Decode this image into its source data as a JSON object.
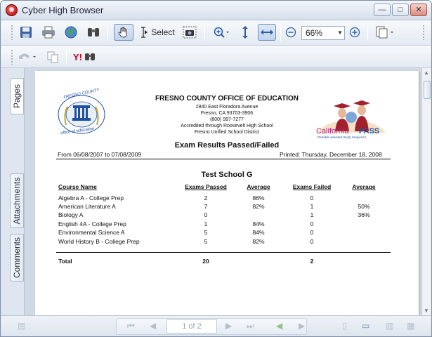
{
  "window": {
    "title": "Cyber High Browser",
    "buttons": {
      "minimize": "—",
      "maximize": "□",
      "close": "✕"
    }
  },
  "toolbar": {
    "select_label": "Select",
    "zoom_value": "66%"
  },
  "sidebar": {
    "tabs": [
      {
        "label": "Pages"
      },
      {
        "label": "Attachments"
      },
      {
        "label": "Comments"
      }
    ]
  },
  "report": {
    "org_name": "FRESNO COUNTY OFFICE OF EDUCATION",
    "address_lines": [
      "2840 East Floradora Avenue",
      "Fresno, CA 93703-3906",
      "(800) 997-7277",
      "Accredited through Roosevelt High School",
      "Fresno Unified School District"
    ],
    "title": "Exam Results Passed/Failed",
    "date_range": "From 06/08/2007 to 07/08/2009",
    "printed": "Printed:  Thursday, December 18, 2008",
    "school": "Test School G",
    "headers": {
      "course": "Course Name",
      "passed": "Exams Passed",
      "avg1": "Average",
      "failed": "Exams Failed",
      "avg2": "Average"
    },
    "rows": [
      {
        "course": "Algebra A - College Prep",
        "passed": "2",
        "avg1": "86%",
        "failed": "0",
        "avg2": ""
      },
      {
        "course": "American Literature A",
        "passed": "7",
        "avg1": "82%",
        "failed": "1",
        "avg2": "50%"
      },
      {
        "course": "Biology A",
        "passed": "0",
        "avg1": "",
        "failed": "1",
        "avg2": "36%"
      },
      {
        "course": "English 4A - College Prep",
        "passed": "1",
        "avg1": "84%",
        "failed": "0",
        "avg2": ""
      },
      {
        "course": "Environmental Science A",
        "passed": "5",
        "avg1": "84%",
        "failed": "0",
        "avg2": ""
      },
      {
        "course": "World History B - College Prep",
        "passed": "5",
        "avg1": "82%",
        "failed": "0",
        "avg2": ""
      }
    ],
    "total": {
      "label": "Total",
      "passed": "20",
      "failed": "2"
    },
    "logo_left": {
      "text_top": "FRESNO COUNTY",
      "text_bottom": "office of education"
    },
    "logo_right": {
      "brand": "California",
      "brand2": "PASS",
      "tagline": "Portable Assisted Study Sequence"
    }
  },
  "statusbar": {
    "page_indicator": "1 of 2"
  },
  "colors": {
    "accent": "#2f5ea8",
    "frame": "#e9eef5",
    "logo_blue": "#1f4fa0",
    "logo_red": "#a3202f"
  }
}
